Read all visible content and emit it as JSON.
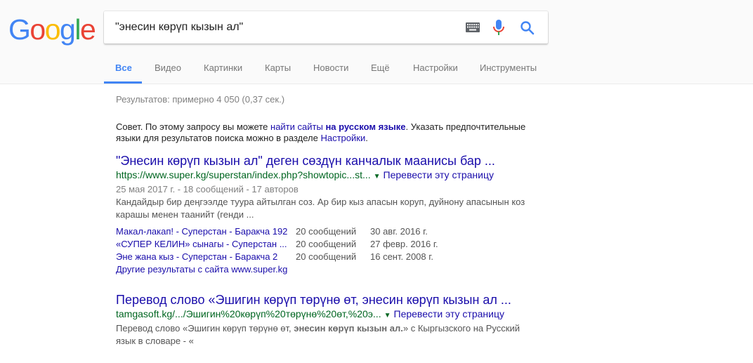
{
  "logo": {
    "letters": [
      "G",
      "o",
      "o",
      "g",
      "l",
      "e"
    ]
  },
  "search": {
    "query": "\"энесин көрүп кызын ал\""
  },
  "tabs": [
    {
      "label": "Все",
      "active": true
    },
    {
      "label": "Видео"
    },
    {
      "label": "Картинки"
    },
    {
      "label": "Карты"
    },
    {
      "label": "Новости"
    },
    {
      "label": "Ещё"
    },
    {
      "label": "Настройки"
    },
    {
      "label": "Инструменты"
    }
  ],
  "stats": "Результатов: примерно 4 050 (0,37 сек.) ",
  "tip": {
    "prefix": "Совет. По этому запросу вы можете ",
    "link1": "найти сайты",
    "link2": "на русском языке",
    "middle": ". Указать предпочтительные языки для результатов поиска можно в разделе ",
    "link3": "Настройки",
    "suffix": "."
  },
  "results": [
    {
      "title": "\"Энесин көрүп кызын ал\" деген сөздүн канчалык маанисы бар ...",
      "url": "https://www.super.kg/superstan/index.php?showtopic...st...",
      "translate": "Перевести эту страницу",
      "meta": "25 мая 2017 г. - 18 сообщений - 17 авторов",
      "snippet": "Кандайдыр бир деңгээлде туура айтылган соз. Ар бир кыз апасын коруп, дуйнону апасынын коз карашы менен таанийт (генди ...",
      "sitelinks": [
        {
          "title": "Макал-лакап! - Суперстан - Баракча 192",
          "count": "20 сообщений",
          "date": "30 авг. 2016 г."
        },
        {
          "title": "«СУПЕР КЕЛИН» сынагы - Суперстан ...",
          "count": "20 сообщений",
          "date": "27 февр. 2016 г."
        },
        {
          "title": "Эне жана кыз - Суперстан - Баракча 2",
          "count": "20 сообщений",
          "date": "16 сент. 2008 г."
        }
      ],
      "more": "Другие результаты с сайта www.super.kg"
    },
    {
      "title": "Перевод слово «Эшигин көрүп төрүнө өт, энесин көрүп кызын ал ...",
      "url": "tamgasoft.kg/.../Эшигин%20көрүп%20төрүнө%20өт,%20э...",
      "translate": "Перевести эту страницу",
      "snippet_pre": "Перевод слово «Эшигин көрүп төрүнө өт, ",
      "snippet_bold": "энесин көрүп кызын ал.",
      "snippet_post": "» с Кыргызского на Русский язык в словаре - «"
    }
  ],
  "colors": {
    "link": "#1a0dab",
    "url": "#006621",
    "accent": "#4285f4"
  }
}
